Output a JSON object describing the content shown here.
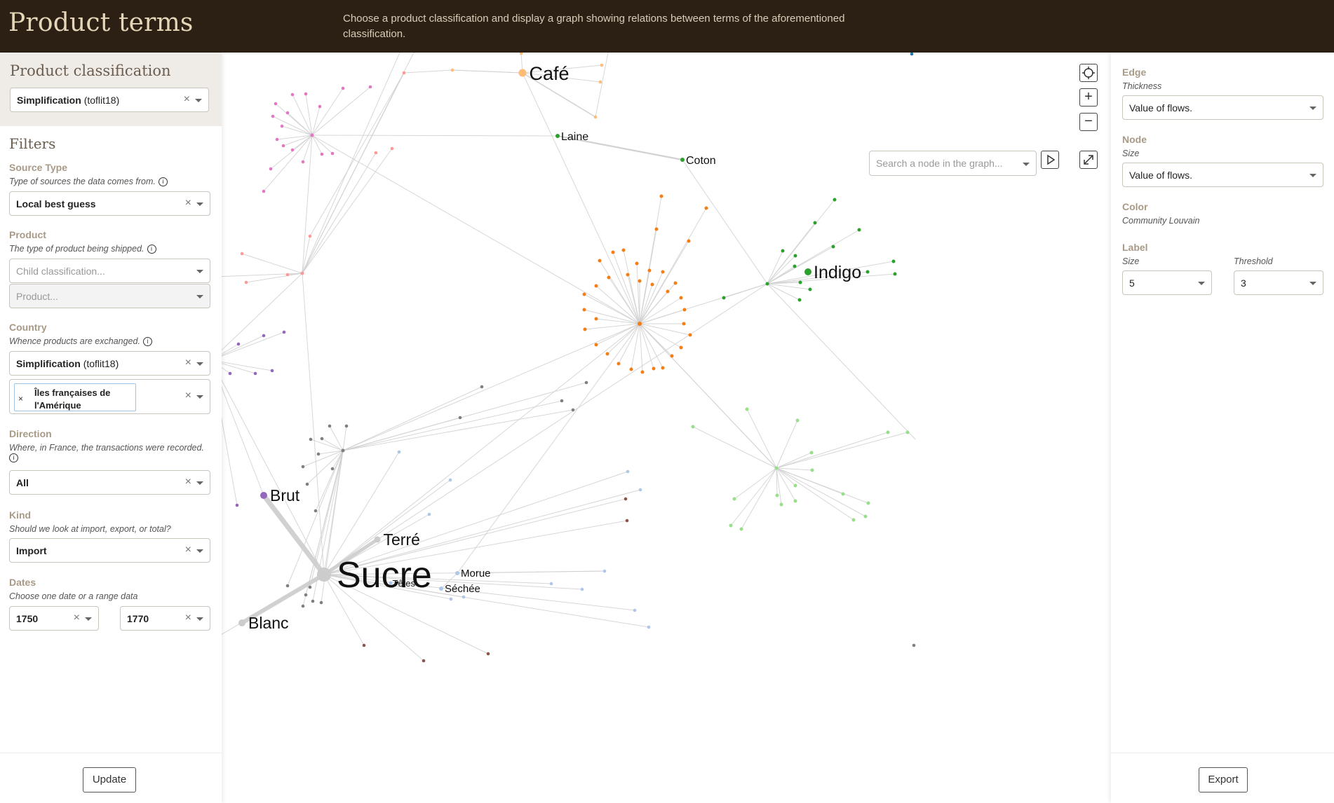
{
  "header": {
    "title": "Product terms",
    "description": "Choose a product classification and display a graph showing relations between terms of the aforementioned classification."
  },
  "left_panel": {
    "classification": {
      "title": "Product classification",
      "selected": "Simplification",
      "selected_sub": "(toflit18)"
    },
    "filters_title": "Filters",
    "source_type": {
      "label": "Source Type",
      "help": "Type of sources the data comes from.",
      "value": "Local best guess"
    },
    "product": {
      "label": "Product",
      "help": "The type of product being shipped.",
      "child_placeholder": "Child classification...",
      "product_placeholder": "Product..."
    },
    "country": {
      "label": "Country",
      "help": "Whence products are exchanged.",
      "classification": "Simplification",
      "classification_sub": "(toflit18)",
      "tag": "Îles françaises de l'Amérique"
    },
    "direction": {
      "label": "Direction",
      "help": "Where, in France, the transactions were recorded.",
      "value": "All"
    },
    "kind": {
      "label": "Kind",
      "help": "Should we look at import, export, or total?",
      "value": "Import"
    },
    "dates": {
      "label": "Dates",
      "help": "Choose one date or a range data",
      "from": "1750",
      "to": "1770"
    },
    "update_label": "Update",
    "clear_symbol": "×",
    "info_symbol": "i"
  },
  "graph_controls": {
    "search_placeholder": "Search a node in the graph...",
    "zoom_in": "+",
    "zoom_out": "−",
    "recenter_icon": "target-icon",
    "play_icon": "play-icon",
    "fullscreen_icon": "expand-icon"
  },
  "graph": {
    "labels": [
      {
        "text": "Café",
        "node": "cafe"
      },
      {
        "text": "Laine",
        "node": "laine"
      },
      {
        "text": "Coton",
        "node": "coton"
      },
      {
        "text": "Indigo",
        "node": "indigo"
      },
      {
        "text": "Brut",
        "node": "brut"
      },
      {
        "text": "Terré",
        "node": "terre"
      },
      {
        "text": "Sucre",
        "node": "sucre"
      },
      {
        "text": "Têtes",
        "node": "tetes"
      },
      {
        "text": "Morue",
        "node": "morue"
      },
      {
        "text": "Séchée",
        "node": "sechee"
      },
      {
        "text": "Blanc",
        "node": "blanc"
      }
    ],
    "colors": {
      "orange": "#f57e13",
      "green": "#2ca02c",
      "lightgreen": "#98df8a",
      "pink": "#e377c2",
      "salmon": "#ff9896",
      "purple": "#9467bd",
      "gray": "#7f7f7f",
      "lightblue": "#aec7e8",
      "brown": "#8c564b",
      "peach": "#ffbb78",
      "cyan": "#17becf",
      "blue": "#1f77b4",
      "edge": "#d0d0d0",
      "sucre": "#cccccc"
    }
  },
  "right_panel": {
    "edge": {
      "label": "Edge",
      "sub": "Thickness",
      "value": "Value of flows."
    },
    "node": {
      "label": "Node",
      "sub": "Size",
      "value": "Value of flows."
    },
    "color": {
      "label": "Color",
      "value": "Community Louvain"
    },
    "label": {
      "label": "Label",
      "size_sub": "Size",
      "size_value": "5",
      "threshold_sub": "Threshold",
      "threshold_value": "3"
    },
    "export_label": "Export"
  }
}
